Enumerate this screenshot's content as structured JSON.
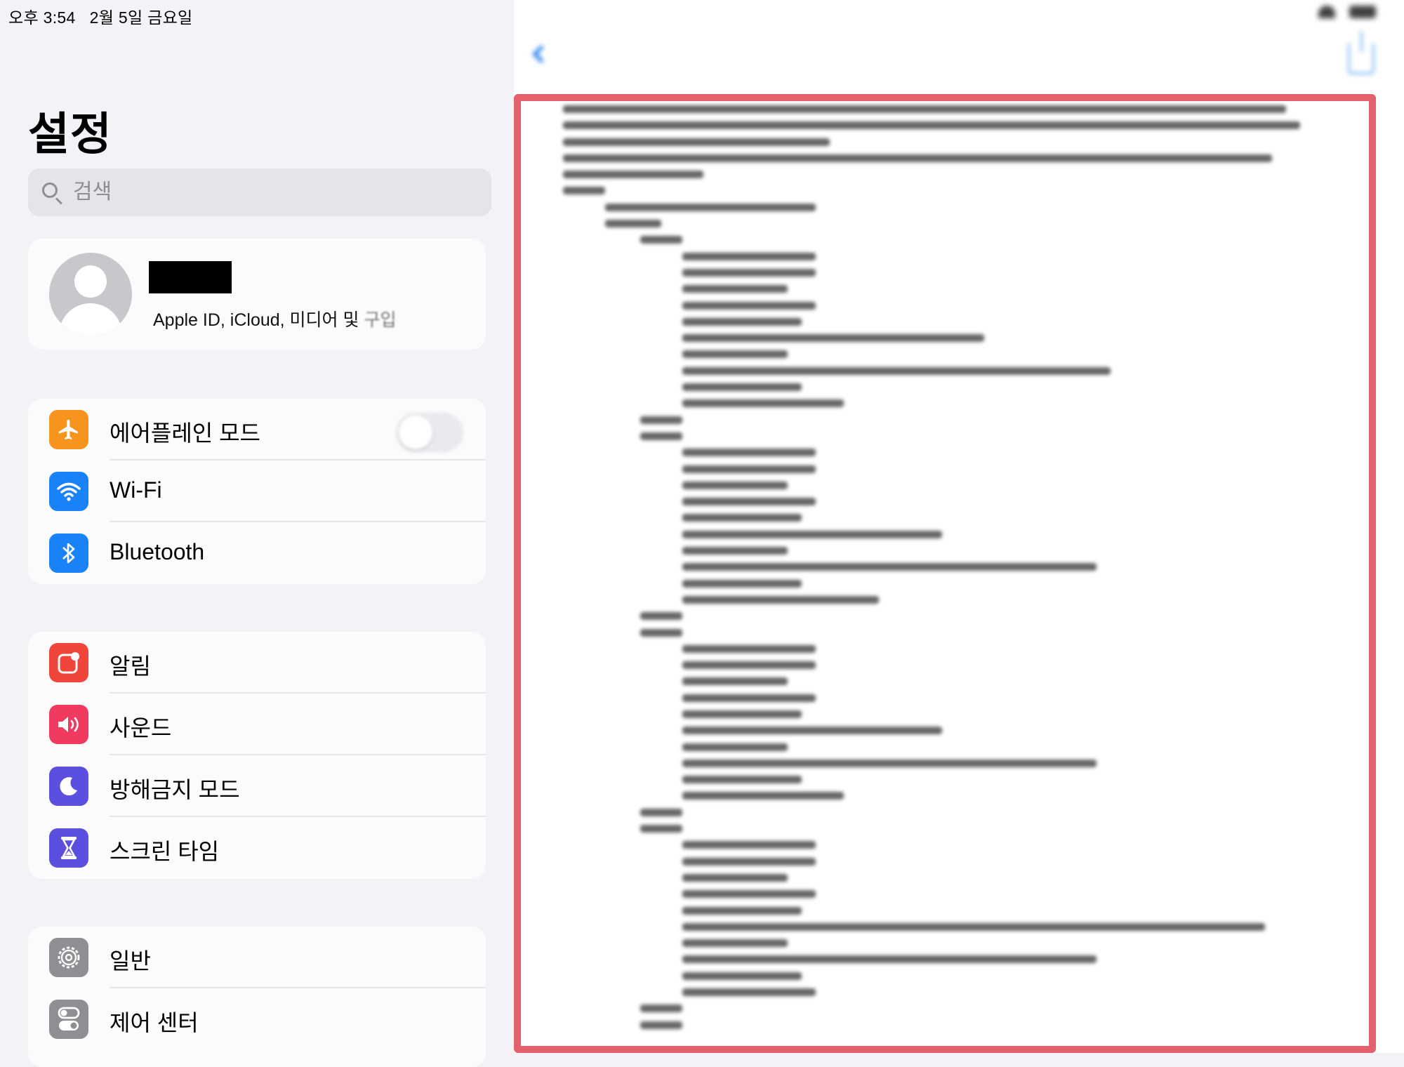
{
  "status_bar": {
    "time": "오후 3:54   2월 5일 금요일",
    "battery": ""
  },
  "sidebar": {
    "title": "설정",
    "search": {
      "placeholder": "검색",
      "icon": "search-icon"
    },
    "profile": {
      "name_redacted": true,
      "subtitle": "Apple ID, iCloud, 미디어 및 ",
      "subtitle_fade": "구입"
    },
    "groups": [
      {
        "items": [
          {
            "label": "에어플레인 모드",
            "icon": "airplane-icon",
            "color": "#f7941d",
            "toggle": false
          },
          {
            "label": "Wi-Fi",
            "icon": "wifi-icon",
            "color": "#1a82f7",
            "value": ""
          },
          {
            "label": "Bluetooth",
            "icon": "bluetooth-icon",
            "color": "#1a82f7",
            "value": ""
          }
        ]
      },
      {
        "items": [
          {
            "label": "알림",
            "icon": "notifications-icon",
            "color": "#f0453a"
          },
          {
            "label": "사운드",
            "icon": "speaker-icon",
            "color": "#f03a5f"
          },
          {
            "label": "방해금지 모드",
            "icon": "moon-icon",
            "color": "#5b4fe0"
          },
          {
            "label": "스크린 타임",
            "icon": "hourglass-icon",
            "color": "#5b4fe0"
          }
        ]
      },
      {
        "items": [
          {
            "label": "일반",
            "icon": "gear-icon",
            "color": "#8e8e93"
          },
          {
            "label": "제어 센터",
            "icon": "control-center-icon",
            "color": "#8e8e93"
          }
        ]
      }
    ]
  },
  "detail": {
    "back_label": "",
    "title": "",
    "highlight_color": "#e4606d",
    "blurred": true
  }
}
